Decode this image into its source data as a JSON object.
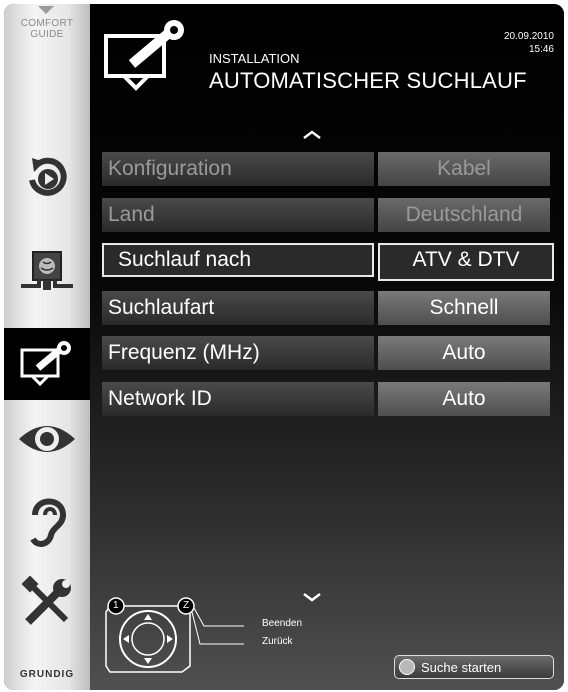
{
  "sidebar": {
    "comfort_line1": "COMFORT",
    "comfort_line2": "GUIDE",
    "icons": [
      "source-icon",
      "network-icon",
      "installation-icon",
      "picture-icon",
      "sound-icon",
      "settings-icon"
    ],
    "brand": "GRUNDIG"
  },
  "header": {
    "date": "20.09.2010",
    "time": "15:46",
    "subtitle": "INSTALLATION",
    "title": "AUTOMATISCHER SUCHLAUF"
  },
  "menu": {
    "rows": [
      {
        "label": "Konfiguration",
        "value": "Kabel",
        "state": "disabled"
      },
      {
        "label": "Land",
        "value": "Deutschland",
        "state": "disabled"
      },
      {
        "label": "Suchlauf nach",
        "value": "ATV & DTV",
        "state": "selected"
      },
      {
        "label": "Suchlaufart",
        "value": "Schnell",
        "state": "normal"
      },
      {
        "label": "Frequenz (MHz)",
        "value": "Auto",
        "state": "normal"
      },
      {
        "label": "Network ID",
        "value": "Auto",
        "state": "normal"
      }
    ]
  },
  "footer": {
    "key1": "1",
    "key2": "Z",
    "hint_exit": "Beenden",
    "hint_back": "Zurück",
    "start_label": "Suche starten"
  },
  "colors": {
    "background": "#000000",
    "sidebar": "#e6e6e6",
    "value_cell": "#5e5e5e",
    "label_cell": "#3a3a3a"
  }
}
